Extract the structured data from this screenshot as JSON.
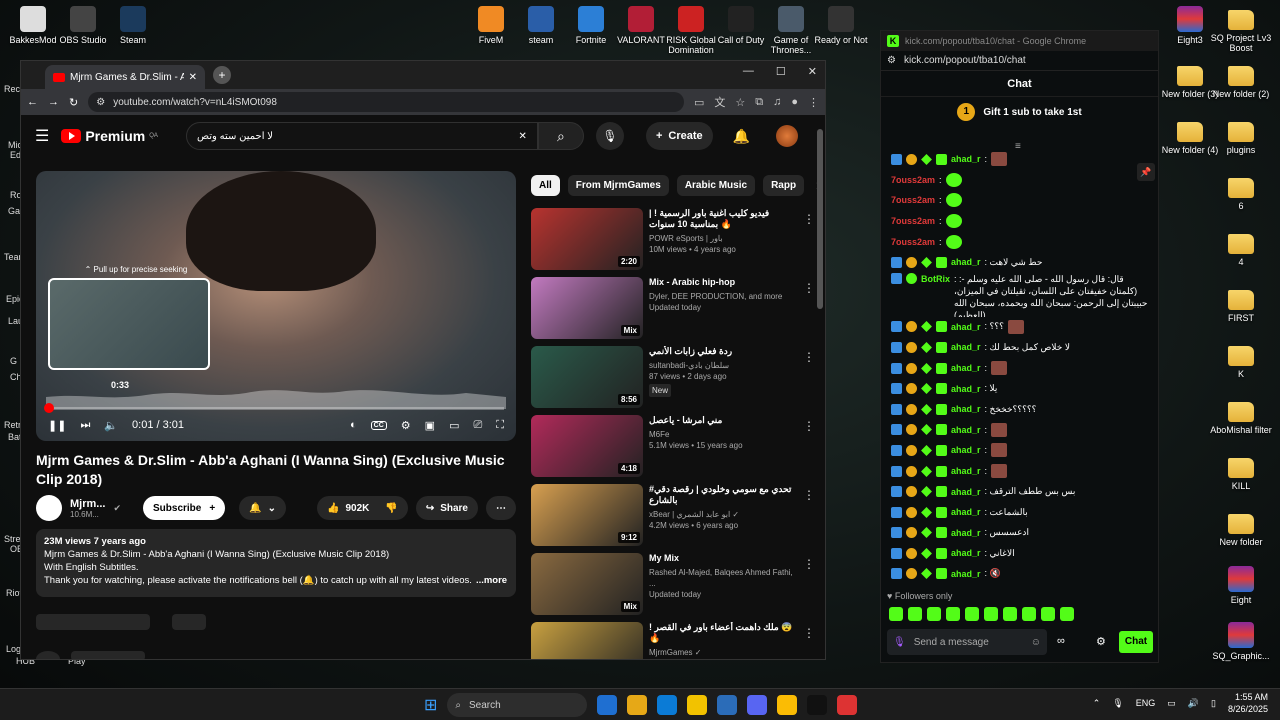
{
  "desktop_top_icons": [
    {
      "label": "BakkesMod",
      "color": "#ddd"
    },
    {
      "label": "OBS Studio",
      "color": "#444"
    },
    {
      "label": "Steam",
      "color": "#1b3a5c"
    },
    {
      "label": "FiveM",
      "color": "#f08a24"
    },
    {
      "label": "steam",
      "color": "#2a5ea8"
    },
    {
      "label": "Fortnite",
      "color": "#2c7fd6"
    },
    {
      "label": "VALORANT",
      "color": "#b21e36"
    },
    {
      "label": "RISK Global Domination",
      "color": "#c22"
    },
    {
      "label": "Call of Duty",
      "color": "#222"
    },
    {
      "label": "Game of Thrones...",
      "color": "#4a5a6a"
    },
    {
      "label": "Ready or Not",
      "color": "#333"
    }
  ],
  "desktop_right_icons": [
    {
      "label": "Eight3",
      "kind": "archive"
    },
    {
      "label": "SQ Project Lv3 Boost",
      "kind": "folder"
    },
    {
      "label": "New folder (3)",
      "kind": "folder"
    },
    {
      "label": "New folder (2)",
      "kind": "folder"
    },
    {
      "label": "New folder (4)",
      "kind": "folder"
    },
    {
      "label": "plugins",
      "kind": "folder"
    },
    {
      "label": "6",
      "kind": "folder"
    },
    {
      "label": "4",
      "kind": "folder"
    },
    {
      "label": "FIRST",
      "kind": "folder"
    },
    {
      "label": "K",
      "kind": "folder"
    },
    {
      "label": "AboMishal filter",
      "kind": "folder"
    },
    {
      "label": "KILL",
      "kind": "folder"
    },
    {
      "label": "New folder",
      "kind": "folder"
    },
    {
      "label": "Eight",
      "kind": "archive"
    },
    {
      "label": "SQ_Graphic...",
      "kind": "archive"
    }
  ],
  "desktop_left_labels": [
    "Recy",
    "Mic",
    "Ed",
    "Ro",
    "Ga",
    "Team",
    "Epic",
    "Lau",
    "G",
    "Ch",
    "Retr",
    "Bat",
    "Strea",
    "OB",
    "Riot",
    "Log",
    "HUB",
    "Play"
  ],
  "browser": {
    "tab_title": "Mjrm Games & Dr.Slim - A",
    "new_tab": "+",
    "minimize": "—",
    "maximize": "☐",
    "close": "✕",
    "url": "youtube.com/watch?v=nL4iSMOt098"
  },
  "youtube": {
    "logo": "Premium",
    "logo_sup": "QA",
    "search_value": "لا احمين سته وتص",
    "create_label": "Create",
    "player": {
      "seek_hint": "⌃ Pull up for precise seeking",
      "preview_time": "0:33",
      "time_display": "0:01 / 3:01",
      "progress": 0.003,
      "cc_label": "CC"
    },
    "title": "Mjrm Games & Dr.Slim - Abb'a Aghani (I Wanna Sing) (Exclusive Music Clip 2018)",
    "channel_name": "Mjrm...",
    "channel_subs": "10.6M...",
    "subscribe_label": "Subscribe",
    "likes": "902K",
    "share_label": "Share",
    "description": {
      "stats": "23M views  7 years ago",
      "line1": "Mjrm Games & Dr.Slim - Abb'a Aghani (I Wanna Sing) (Exclusive Music Clip 2018)",
      "line2": "With English Subtitles.",
      "line3": "Thank you for watching, please activate the notifications bell (🔔) to catch up with all my latest videos.",
      "more": "...more"
    },
    "chips": [
      "All",
      "From MjrmGames",
      "Arabic Music",
      "Rapp"
    ],
    "recommendations": [
      {
        "title": "فيديو كليب اغنية باور الرسمية ! | بمناسبة 10 سنوات 🔥",
        "channel": "POWR eSports | باور",
        "meta": "10M views • 4 years ago",
        "duration": "2:20",
        "badge": "",
        "color": "#b8332f"
      },
      {
        "title": "Mix - Arabic hip-hop",
        "channel": "Dyler, DEE PRODUCTION, and more",
        "meta": "Updated today",
        "duration": "Mix",
        "badge": "",
        "color": "#c27ac0"
      },
      {
        "title": "ردة فعلي زابات الأنمي",
        "channel": "sultanbadi-سلطان بادي",
        "meta": "87 views • 2 days ago",
        "duration": "8:56",
        "badge": "New",
        "color": "#2a5a4a"
      },
      {
        "title": "مني امرشا - ياعصل",
        "channel": "M6Fe",
        "meta": "5.1M views • 15 years ago",
        "duration": "4:18",
        "badge": "",
        "color": "#b22a5a"
      },
      {
        "title": "#تحدي مع سومي وخلودي | رقصة دقي بالشارع",
        "channel": "xBear | ابو عابد الشمري ✓",
        "meta": "4.2M views • 6 years ago",
        "duration": "9:12",
        "badge": "",
        "color": "#d8a050"
      },
      {
        "title": "My Mix",
        "channel": "Rashed Al-Majed, Balqees Ahmed Fathi, ...",
        "meta": "Updated today",
        "duration": "Mix",
        "badge": "",
        "color": "#8a6a40"
      },
      {
        "title": "! ملك داهمت أعضاء باور في القصر 😨🔥",
        "channel": "MjrmGames ✓",
        "meta": "",
        "duration": "",
        "badge": "",
        "color": "#c8a040"
      }
    ]
  },
  "kick": {
    "window_title": "kick.com/popout/tba10/chat - Google Chrome",
    "url": "kick.com/popout/tba10/chat",
    "header": "Chat",
    "gift_num": "1",
    "gift_text": "Gift 1 sub to take 1st",
    "messages": [
      {
        "user": "ahad_r",
        "color": "#53fc18",
        "badges": 4,
        "text": ":",
        "emote": "img"
      },
      {
        "user": "7ouss2am",
        "color": "#e03a3a",
        "badges": 0,
        "text": ":",
        "emote": "green"
      },
      {
        "user": "7ouss2am",
        "color": "#e03a3a",
        "badges": 0,
        "text": ":",
        "emote": "green"
      },
      {
        "user": "7ouss2am",
        "color": "#e03a3a",
        "badges": 0,
        "text": ":",
        "emote": "green"
      },
      {
        "user": "7ouss2am",
        "color": "#e03a3a",
        "badges": 0,
        "text": ":",
        "emote": "green"
      },
      {
        "user": "ahad_r",
        "color": "#53fc18",
        "badges": 4,
        "text": ": حط شي لاهت",
        "emote": ""
      },
      {
        "user": "BotRix",
        "color": "#53fc18",
        "badges": 2,
        "text": ": قال: قال رسول الله - صلى الله عليه وسلم -: (كلمتان خفيفتان على اللسان، ثقيلتان في الميزان، حبيبتان إلى الرحمن: سبحان الله وبحمده، سبحان الله العظيم))",
        "emote": "",
        "tall": true
      },
      {
        "user": "ahad_r",
        "color": "#53fc18",
        "badges": 4,
        "text": ": ؟؟؟",
        "emote": "img"
      },
      {
        "user": "ahad_r",
        "color": "#53fc18",
        "badges": 4,
        "text": ": لا خلاص كمل بحط لك",
        "emote": ""
      },
      {
        "user": "ahad_r",
        "color": "#53fc18",
        "badges": 4,
        "text": ":",
        "emote": "img"
      },
      {
        "user": "ahad_r",
        "color": "#53fc18",
        "badges": 4,
        "text": ": يلا",
        "emote": ""
      },
      {
        "user": "ahad_r",
        "color": "#53fc18",
        "badges": 4,
        "text": ": ؟؟؟؟؟خخخخ",
        "emote": ""
      },
      {
        "user": "ahad_r",
        "color": "#53fc18",
        "badges": 4,
        "text": ":",
        "emote": "img"
      },
      {
        "user": "ahad_r",
        "color": "#53fc18",
        "badges": 4,
        "text": ":",
        "emote": "img"
      },
      {
        "user": "ahad_r",
        "color": "#53fc18",
        "badges": 4,
        "text": ":",
        "emote": "img"
      },
      {
        "user": "ahad_r",
        "color": "#53fc18",
        "badges": 4,
        "text": ": بس بس ططف الترقف",
        "emote": ""
      },
      {
        "user": "ahad_r",
        "color": "#53fc18",
        "badges": 4,
        "text": ": بالشماعت",
        "emote": ""
      },
      {
        "user": "ahad_r",
        "color": "#53fc18",
        "badges": 4,
        "text": ": ادعسسس",
        "emote": ""
      },
      {
        "user": "ahad_r",
        "color": "#53fc18",
        "badges": 4,
        "text": ": الاغاني",
        "emote": ""
      },
      {
        "user": "ahad_r",
        "color": "#53fc18",
        "badges": 4,
        "text": ": 🔇",
        "emote": ""
      }
    ],
    "followers_label": "Followers only",
    "input_placeholder": "Send a message",
    "chat_button": "Chat"
  },
  "taskbar": {
    "search_label": "Search",
    "apps": [
      "#1f6fd1",
      "#e6a817",
      "#0b7bd6",
      "#f2c200",
      "#2b6cb8",
      "#5865f2",
      "#fbbc04",
      "#111",
      "#d33"
    ],
    "lang": "ENG",
    "time": "1:55 AM",
    "date": "8/26/2025"
  }
}
